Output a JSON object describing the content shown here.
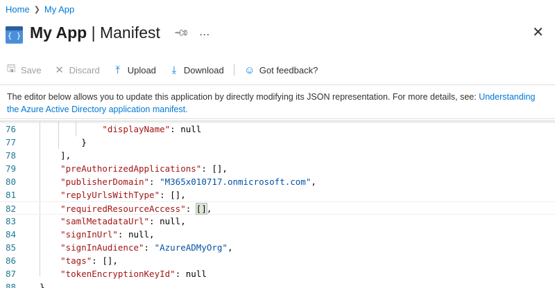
{
  "breadcrumb": {
    "home": "Home",
    "app": "My App"
  },
  "header": {
    "app_name": "My App",
    "separator": " | ",
    "section": "Manifest",
    "icon_glyph": "{ }"
  },
  "toolbar": {
    "save": "Save",
    "discard": "Discard",
    "upload": "Upload",
    "download": "Download",
    "feedback": "Got feedback?"
  },
  "info": {
    "text": "The editor below allows you to update this application by directly modifying its JSON representation. For more details, see: ",
    "link": "Understanding the Azure Active Directory application manifest."
  },
  "editor": {
    "lines": [
      {
        "num": "76",
        "indent": "            ",
        "key": "\"displayName\"",
        "rest": ": null"
      },
      {
        "num": "77",
        "indent": "        ",
        "key": "",
        "rest": "}"
      },
      {
        "num": "78",
        "indent": "    ",
        "key": "",
        "rest": "],"
      },
      {
        "num": "79",
        "indent": "    ",
        "key": "\"preAuthorizedApplications\"",
        "rest": ": [],"
      },
      {
        "num": "80",
        "indent": "    ",
        "key": "\"publisherDomain\"",
        "rest": ": ",
        "str": "\"M365x010717.onmicrosoft.com\"",
        "tail": ","
      },
      {
        "num": "81",
        "indent": "    ",
        "key": "\"replyUrlsWithType\"",
        "rest": ": [],"
      },
      {
        "num": "82",
        "indent": "    ",
        "key": "\"requiredResourceAccess\"",
        "rest": ": ",
        "hl": "[]",
        "tail": ","
      },
      {
        "num": "83",
        "indent": "    ",
        "key": "\"samlMetadataUrl\"",
        "rest": ": null,"
      },
      {
        "num": "84",
        "indent": "    ",
        "key": "\"signInUrl\"",
        "rest": ": null,"
      },
      {
        "num": "85",
        "indent": "    ",
        "key": "\"signInAudience\"",
        "rest": ": ",
        "str": "\"AzureADMyOrg\"",
        "tail": ","
      },
      {
        "num": "86",
        "indent": "    ",
        "key": "\"tags\"",
        "rest": ": [],"
      },
      {
        "num": "87",
        "indent": "    ",
        "key": "\"tokenEncryptionKeyId\"",
        "rest": ": null"
      },
      {
        "num": "88",
        "indent": "",
        "key": "",
        "rest": "}"
      }
    ],
    "current_line": "82"
  }
}
